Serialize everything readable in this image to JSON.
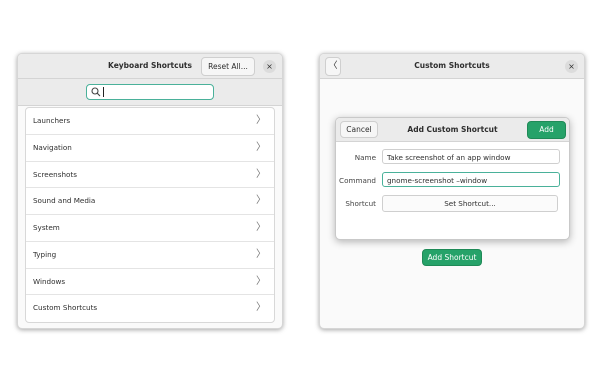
{
  "left_window": {
    "title": "Keyboard Shortcuts",
    "reset_label": "Reset All...",
    "close_glyph": "×",
    "search": {
      "value": "",
      "icon": "search-icon"
    },
    "items": [
      {
        "label": "Launchers"
      },
      {
        "label": "Navigation"
      },
      {
        "label": "Screenshots"
      },
      {
        "label": "Sound and Media"
      },
      {
        "label": "System"
      },
      {
        "label": "Typing"
      },
      {
        "label": "Windows"
      },
      {
        "label": "Custom Shortcuts"
      }
    ],
    "chevron_glyph": "〉",
    "annotation_arrow_color": "#e01b24"
  },
  "right_window": {
    "title": "Custom Shortcuts",
    "back_glyph": "〈",
    "close_glyph": "×",
    "add_shortcut_label": "Add Shortcut",
    "dialog": {
      "title": "Add Custom Shortcut",
      "cancel_label": "Cancel",
      "add_label": "Add",
      "name_label": "Name",
      "name_value": "Take screenshot of an app window",
      "command_label": "Command",
      "command_value": "gnome-screenshot –window",
      "shortcut_label": "Shortcut",
      "set_shortcut_label": "Set Shortcut..."
    }
  },
  "colors": {
    "accent_green": "#26a269",
    "focus_ring": "#4ab19a",
    "arrow_red": "#e01b24"
  }
}
